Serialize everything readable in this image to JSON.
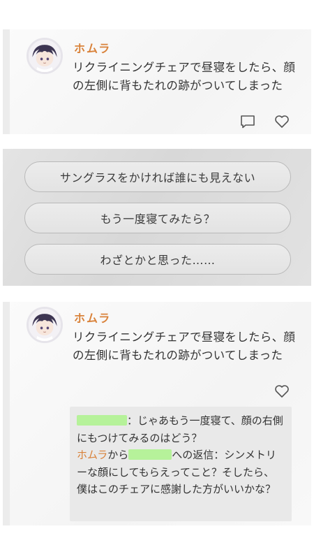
{
  "post_1": {
    "author": "ホムラ",
    "text": "リクライニングチェアで昼寝をしたら、顔の左側に背もたれの跡がついてしまった",
    "icons": [
      "comment-icon",
      "heart-icon"
    ]
  },
  "choices": [
    "サングラスをかければ誰にも見えない",
    "もう一度寝てみたら？",
    "わざとかと思った……"
  ],
  "post_2": {
    "author": "ホムラ",
    "text": "リクライニングチェアで昼寝をしたら、顔の左側に背もたれの跡がついてしまった",
    "icons": [
      "heart-icon"
    ],
    "reply": {
      "user_comment": "：じゃあもう一度寝て、顔の右側にもつけてみるのはどう？",
      "reply_author": "ホムラ",
      "reply_from": "から",
      "reply_to_suffix": "への返信：",
      "reply_text": "シンメトリーな顔にしてもらえってこと？そしたら、僕はこのチェアに感謝した方がいいかな？"
    }
  },
  "colors": {
    "author_name": "#d9823a",
    "redaction": "#b6f29a"
  }
}
